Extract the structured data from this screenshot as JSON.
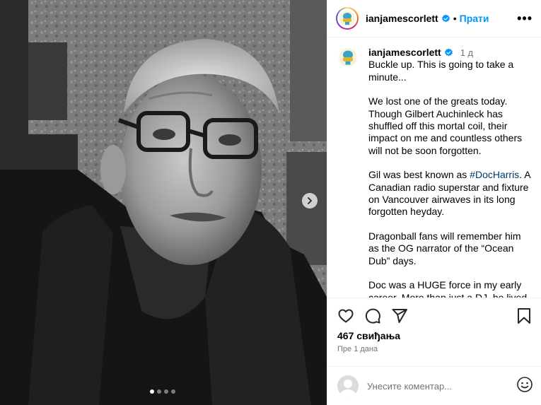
{
  "post": {
    "photo_alt": "Black and white portrait of an elderly man with glasses",
    "carousel": {
      "slides": 4,
      "active_index": 0
    }
  },
  "header": {
    "username": "ianjamescorlett",
    "separator": "•",
    "follow_label": "Прати",
    "more_label": "•••"
  },
  "caption": {
    "username": "ianjamescorlett",
    "time_ago": "1 д",
    "paragraphs": {
      "p1": "Buckle up. This is going to take a minute...",
      "p2": "We lost one of the greats today. Though Gilbert Auchinleck has shuffled off this mortal coil, their impact on me and countless others will not be soon forgotten.",
      "p3_before": "Gil was best known as ",
      "p3_hashtag": "#DocHarris",
      "p3_after": ". A Canadian radio superstar and fixture on Vancouver airwaves in its long forgotten heyday.",
      "p4": "Dragonball fans will remember him as the OG narrator of the “Ocean Dub” days.",
      "p5": "Doc was a HUGE force in my early career. More than just a DJ, he lived"
    }
  },
  "stats": {
    "likes": "467 свиђања",
    "date_ago": "Пре 1 дана"
  },
  "comment": {
    "placeholder": "Унесите коментар..."
  },
  "icons": {
    "verified": "verified-badge-icon",
    "like": "heart-icon",
    "comment": "comment-icon",
    "share": "share-icon",
    "save": "bookmark-icon",
    "emoji": "emoji-icon",
    "next": "chevron-right-icon"
  },
  "colors": {
    "accent": "#0095f6",
    "verified": "#0095f6",
    "hashtag": "#00376b",
    "muted": "#737373"
  }
}
